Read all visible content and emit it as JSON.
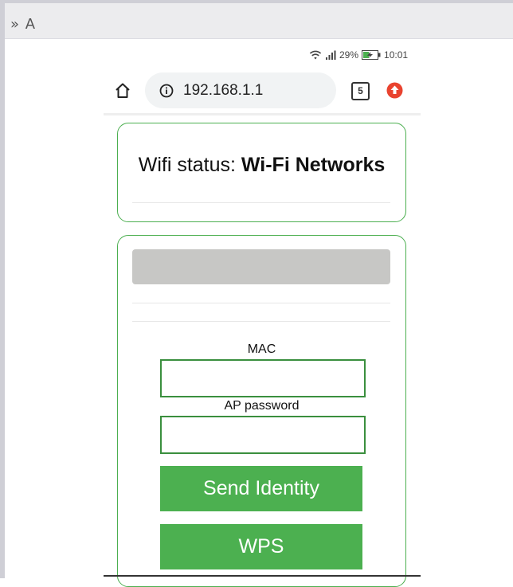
{
  "topbar": {
    "label": "» A"
  },
  "status_bar": {
    "battery": "29%",
    "time": "10:01",
    "icons": [
      "wifi-icon",
      "signal-icon",
      "battery-charging-icon"
    ]
  },
  "browser": {
    "url": "192.168.1.1",
    "tab_count": "5",
    "icons": [
      "home-icon",
      "info-icon",
      "tabs-icon",
      "update-icon"
    ]
  },
  "status_card": {
    "prefix": "Wifi status: ",
    "value": "Wi-Fi Networks"
  },
  "form": {
    "mac_label": "MAC",
    "mac_value": "",
    "password_label": "AP password",
    "password_value": "",
    "send_button": "Send Identity",
    "wps_button": "WPS"
  },
  "colors": {
    "accent_green": "#4cb050",
    "border_green": "#4caf50",
    "update_red": "#e9432f"
  }
}
